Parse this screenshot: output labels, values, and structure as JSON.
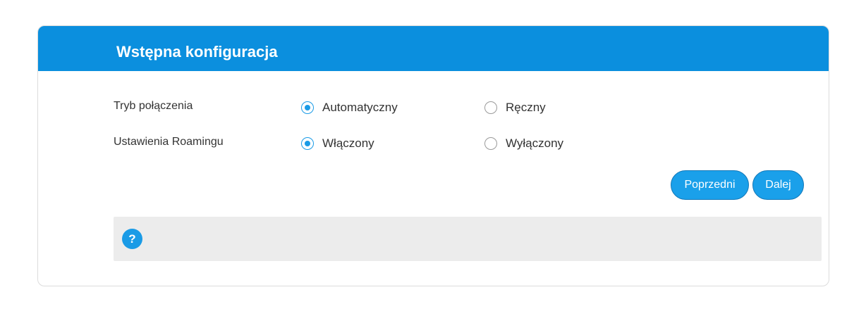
{
  "header": {
    "title": "Wstępna konfiguracja"
  },
  "form": {
    "connection_mode": {
      "label": "Tryb połączenia",
      "options": [
        {
          "label": "Automatyczny",
          "selected": true
        },
        {
          "label": "Ręczny",
          "selected": false
        }
      ]
    },
    "roaming": {
      "label": "Ustawienia Roamingu",
      "options": [
        {
          "label": "Włączony",
          "selected": true
        },
        {
          "label": "Wyłączony",
          "selected": false
        }
      ]
    }
  },
  "buttons": {
    "previous_label": "Poprzedni",
    "next_label": "Dalej"
  },
  "help": {
    "icon": "help-icon",
    "glyph": "?"
  },
  "colors": {
    "header_bg": "#0b8fde",
    "accent": "#1a9be6",
    "help_box_bg": "#ececec"
  }
}
